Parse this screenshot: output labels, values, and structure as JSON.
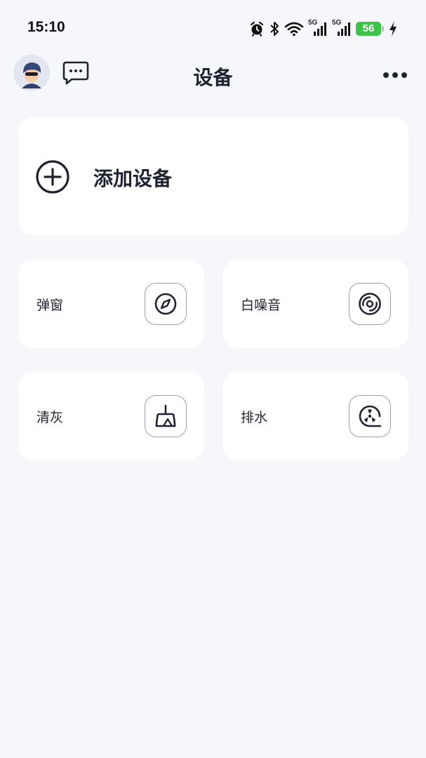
{
  "status_bar": {
    "time": "15:10",
    "network_1": "5G",
    "network_2": "5G",
    "battery": "56",
    "battery_color": "#3ec34a"
  },
  "header": {
    "title": "设备",
    "avatar_icon": "user-avatar",
    "message_icon": "chat-bubble-icon",
    "more_icon": "more-dots-icon"
  },
  "add_device": {
    "label": "添加设备",
    "icon": "plus-circle-icon"
  },
  "modes": [
    {
      "label": "弹窗",
      "icon": "compass-icon"
    },
    {
      "label": "白噪音",
      "icon": "disc-icon"
    },
    {
      "label": "清灰",
      "icon": "broom-icon"
    },
    {
      "label": "排水",
      "icon": "fan-drain-icon"
    }
  ],
  "colors": {
    "background": "#f6f7fb",
    "card": "#ffffff",
    "text": "#1f2330"
  }
}
